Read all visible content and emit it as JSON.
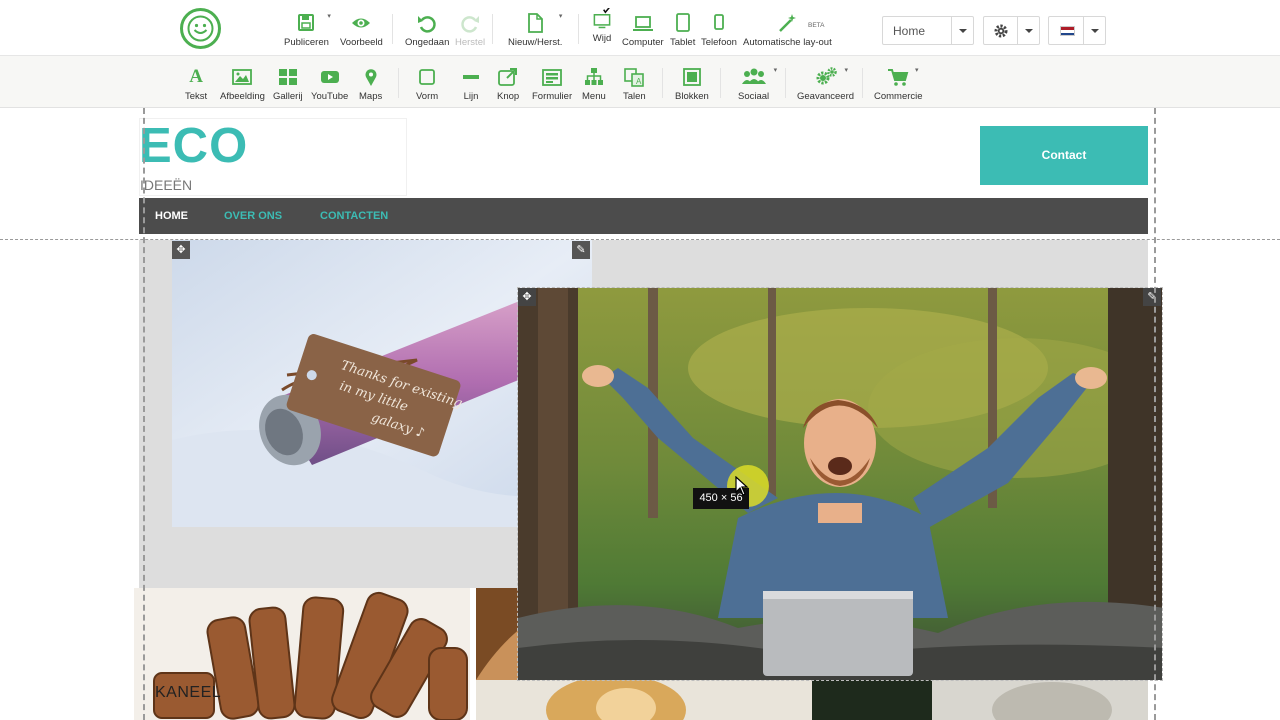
{
  "toolbar_top": {
    "items": [
      {
        "label": "Publiceren",
        "icon": "save-icon"
      },
      {
        "label": "Voorbeeld",
        "icon": "eye-icon"
      },
      {
        "label": "Ongedaan",
        "icon": "undo-icon"
      },
      {
        "label": "Herstel",
        "icon": "redo-icon"
      },
      {
        "label": "Nieuw/Herst.",
        "icon": "page-icon"
      },
      {
        "label": "Wijd",
        "icon": "monitor-icon"
      },
      {
        "label": "Computer",
        "icon": "laptop-icon"
      },
      {
        "label": "Tablet",
        "icon": "tablet-icon"
      },
      {
        "label": "Telefoon",
        "icon": "phone-icon"
      },
      {
        "label": "Automatische lay-out",
        "icon": "magic-wand-icon"
      }
    ],
    "beta": "BETA",
    "page_select": "Home"
  },
  "toolbar_bottom": {
    "items": [
      {
        "label": "Tekst",
        "icon": "text-icon"
      },
      {
        "label": "Afbeelding",
        "icon": "image-icon"
      },
      {
        "label": "Gallerij",
        "icon": "gallery-icon"
      },
      {
        "label": "YouTube",
        "icon": "youtube-icon"
      },
      {
        "label": "Maps",
        "icon": "map-pin-icon"
      },
      {
        "label": "Vorm",
        "icon": "shape-icon"
      },
      {
        "label": "Lijn",
        "icon": "line-icon"
      },
      {
        "label": "Knop",
        "icon": "button-icon"
      },
      {
        "label": "Formulier",
        "icon": "form-icon"
      },
      {
        "label": "Menu",
        "icon": "menu-icon"
      },
      {
        "label": "Talen",
        "icon": "translate-icon"
      },
      {
        "label": "Blokken",
        "icon": "blocks-icon"
      },
      {
        "label": "Sociaal",
        "icon": "social-icon"
      },
      {
        "label": "Geavanceerd",
        "icon": "gears-icon"
      },
      {
        "label": "Commercie",
        "icon": "cart-icon"
      }
    ]
  },
  "site": {
    "brand": "ECO",
    "tagline": "IDEEËN",
    "contact_button": "Contact",
    "nav": [
      "HOME",
      "OVER ONS",
      "CONTACTEN"
    ],
    "caption": "KANEEL",
    "size_tooltip": "450 × 56"
  },
  "colors": {
    "accent": "#3cbcb4",
    "toolbar_green": "#4caf50",
    "navbar": "#4c4c4c"
  }
}
